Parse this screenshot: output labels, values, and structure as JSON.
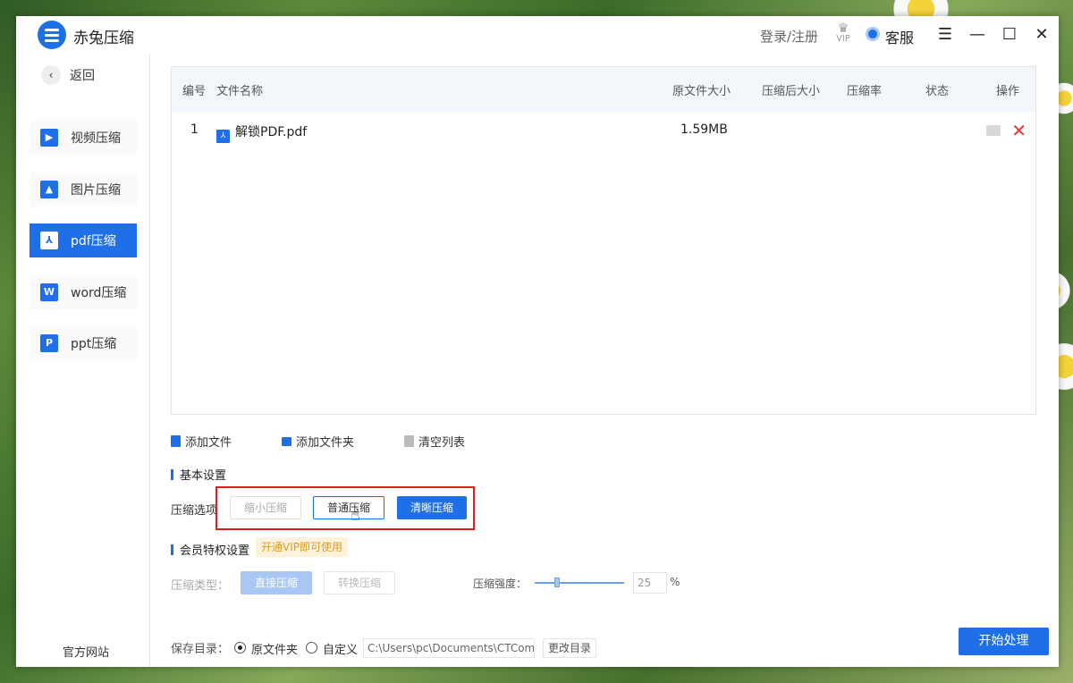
{
  "app": {
    "title": "赤兔压缩",
    "login": "登录/注册",
    "vip_label": "VIP",
    "service": "客服"
  },
  "sidebar": {
    "back": "返回",
    "items": [
      {
        "label": "视频压缩",
        "icon": "video-icon"
      },
      {
        "label": "图片压缩",
        "icon": "image-icon"
      },
      {
        "label": "pdf压缩",
        "icon": "pdf-icon",
        "active": true
      },
      {
        "label": "word压缩",
        "icon": "word-icon"
      },
      {
        "label": "ppt压缩",
        "icon": "ppt-icon"
      }
    ],
    "official": "官方网站"
  },
  "table": {
    "headers": [
      "编号",
      "文件名称",
      "原文件大小",
      "压缩后大小",
      "压缩率",
      "状态",
      "操作"
    ],
    "rows": [
      {
        "no": "1",
        "name": "解锁PDF.pdf",
        "size": "1.59MB",
        "after": "",
        "rate": "",
        "status": ""
      }
    ]
  },
  "actions": {
    "add_file": "添加文件",
    "add_folder": "添加文件夹",
    "clear": "清空列表"
  },
  "basic": {
    "title": "基本设置",
    "option_label": "压缩选项",
    "options": [
      "缩小压缩",
      "普通压缩",
      "清晰压缩"
    ],
    "selected": "清晰压缩"
  },
  "vip": {
    "title": "会员特权设置",
    "tag": "开通VIP即可使用",
    "type_label": "压缩类型：",
    "types": [
      "直接压缩",
      "转换压缩"
    ],
    "strength_label": "压缩强度：",
    "strength": "25",
    "unit": "%"
  },
  "save": {
    "label": "保存目录：",
    "opt1": "原文件夹",
    "opt2": "自定义",
    "path": "C:\\Users\\pc\\Documents\\CTCom",
    "change": "更改目录"
  },
  "start": "开始处理",
  "colors": {
    "accent": "#1e6fe8",
    "highlight": "#d9201a",
    "vip_tag": "#e39a16"
  }
}
